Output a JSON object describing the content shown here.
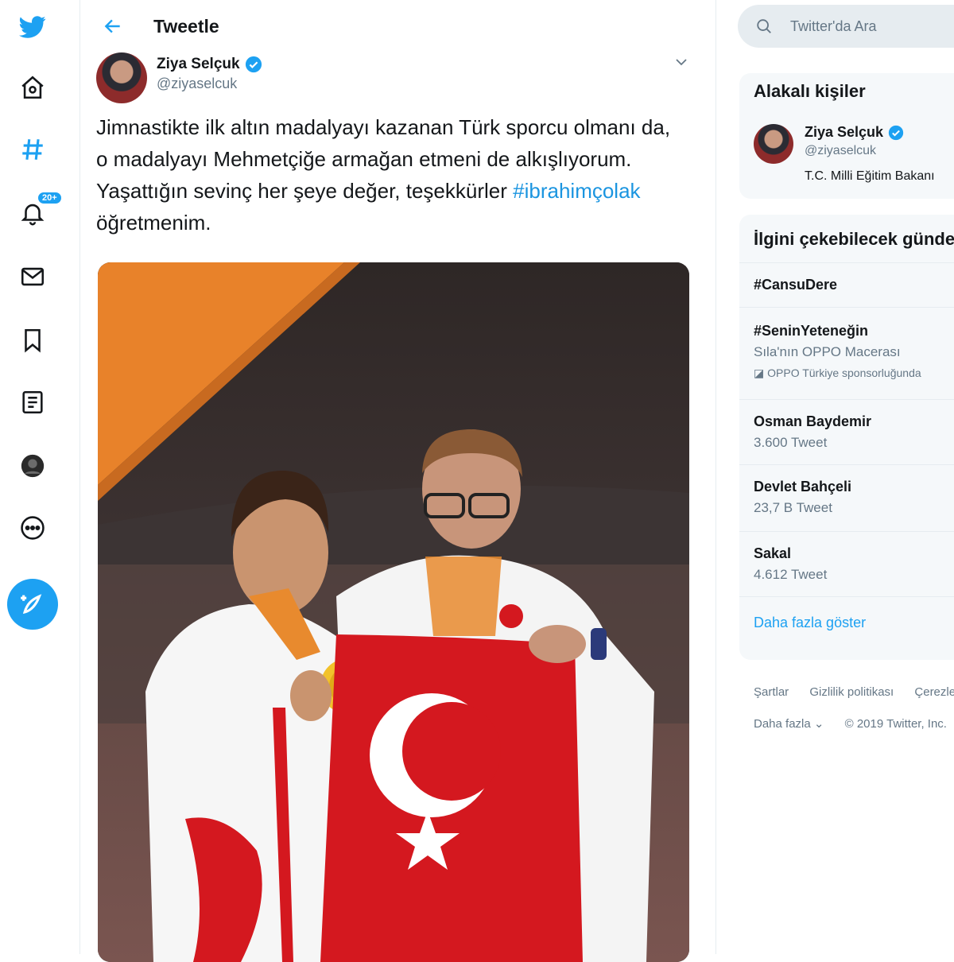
{
  "nav": {
    "notifications_badge": "20+",
    "items": [
      "twitter-logo",
      "home-icon",
      "explore-icon",
      "notifications-icon",
      "messages-icon",
      "bookmarks-icon",
      "lists-icon",
      "profile-icon",
      "more-icon"
    ]
  },
  "header": {
    "title": "Tweetle"
  },
  "tweet": {
    "author_name": "Ziya Selçuk",
    "author_handle": "@ziyaselcuk",
    "text_parts": {
      "before": "Jimnastikte ilk altın madalyayı kazanan Türk sporcu olmanı da, o madalyayı Mehmetçiğe armağan etmeni de alkışlıyorum. Yaşattığın sevinç her şeye değer, teşekkürler ",
      "hashtag": "#ibrahimçolak",
      "after": " öğretmenim."
    }
  },
  "search": {
    "placeholder": "Twitter'da Ara"
  },
  "related": {
    "title": "Alakalı kişiler",
    "name": "Ziya Selçuk",
    "handle": "@ziyaselcuk",
    "bio": "T.C. Milli Eğitim Bakanı"
  },
  "trends": {
    "title": "İlgini çekebilecek gündemler",
    "items": [
      {
        "name": "#CansuDere",
        "sub": ""
      },
      {
        "name": "#SeninYeteneğin",
        "sub": "Sıla'nın OPPO Macerası",
        "promo": "OPPO Türkiye sponsorluğunda"
      },
      {
        "name": "Osman Baydemir",
        "sub": "3.600 Tweet"
      },
      {
        "name": "Devlet Bahçeli",
        "sub": "23,7 B Tweet"
      },
      {
        "name": "Sakal",
        "sub": "4.612 Tweet"
      }
    ],
    "show_more": "Daha fazla göster"
  },
  "footer": {
    "links": [
      "Şartlar",
      "Gizlilik politikası",
      "Çerezler"
    ],
    "more": "Daha fazla ⌄",
    "copyright": "© 2019 Twitter, Inc."
  },
  "colors": {
    "accent": "#1da1f2",
    "flag_red": "#d4181f",
    "orange": "#e8822a"
  }
}
